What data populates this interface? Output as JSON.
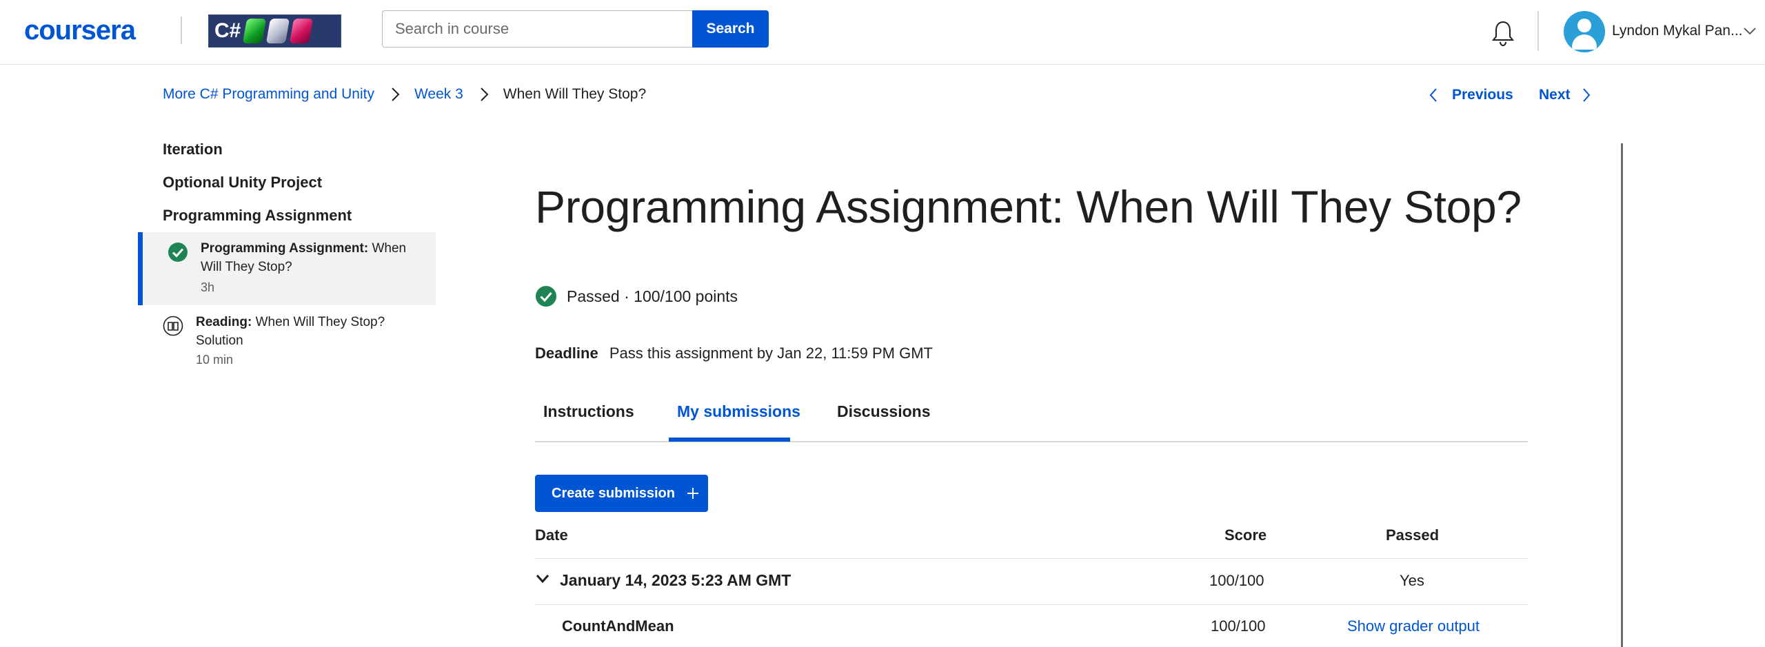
{
  "header": {
    "logo": "coursera",
    "course_badge_text": "C#",
    "search_placeholder": "Search in course",
    "search_button": "Search",
    "user_name": "Lyndon Mykal Pan..."
  },
  "breadcrumb": {
    "items": [
      "More C# Programming and Unity",
      "Week 3",
      "When Will They Stop?"
    ]
  },
  "pager": {
    "previous": "Previous",
    "next": "Next"
  },
  "sidebar": {
    "sections": [
      "Iteration",
      "Optional Unity Project",
      "Programming Assignment"
    ],
    "items": [
      {
        "type": "Programming Assignment:",
        "name": "When Will They Stop?",
        "meta": "3h"
      },
      {
        "type": "Reading:",
        "name": "When Will They Stop? Solution",
        "meta": "10 min"
      }
    ]
  },
  "main": {
    "title": "Programming Assignment: When Will They Stop?",
    "status": "Passed · 100/100 points",
    "deadline_label": "Deadline",
    "deadline_text": "Pass this assignment by Jan 22, 11:59 PM GMT",
    "tabs": [
      "Instructions",
      "My submissions",
      "Discussions"
    ],
    "create_button": "Create submission",
    "table": {
      "headers": [
        "Date",
        "Score",
        "Passed"
      ],
      "submission": {
        "date": "January 14, 2023 5:23 AM GMT",
        "score": "100/100",
        "passed": "Yes"
      },
      "parts": [
        {
          "name": "CountAndMean",
          "score": "100/100",
          "action": "Show grader output"
        }
      ]
    }
  },
  "colors": {
    "brand": "#0056d2",
    "success": "#1f8354"
  }
}
